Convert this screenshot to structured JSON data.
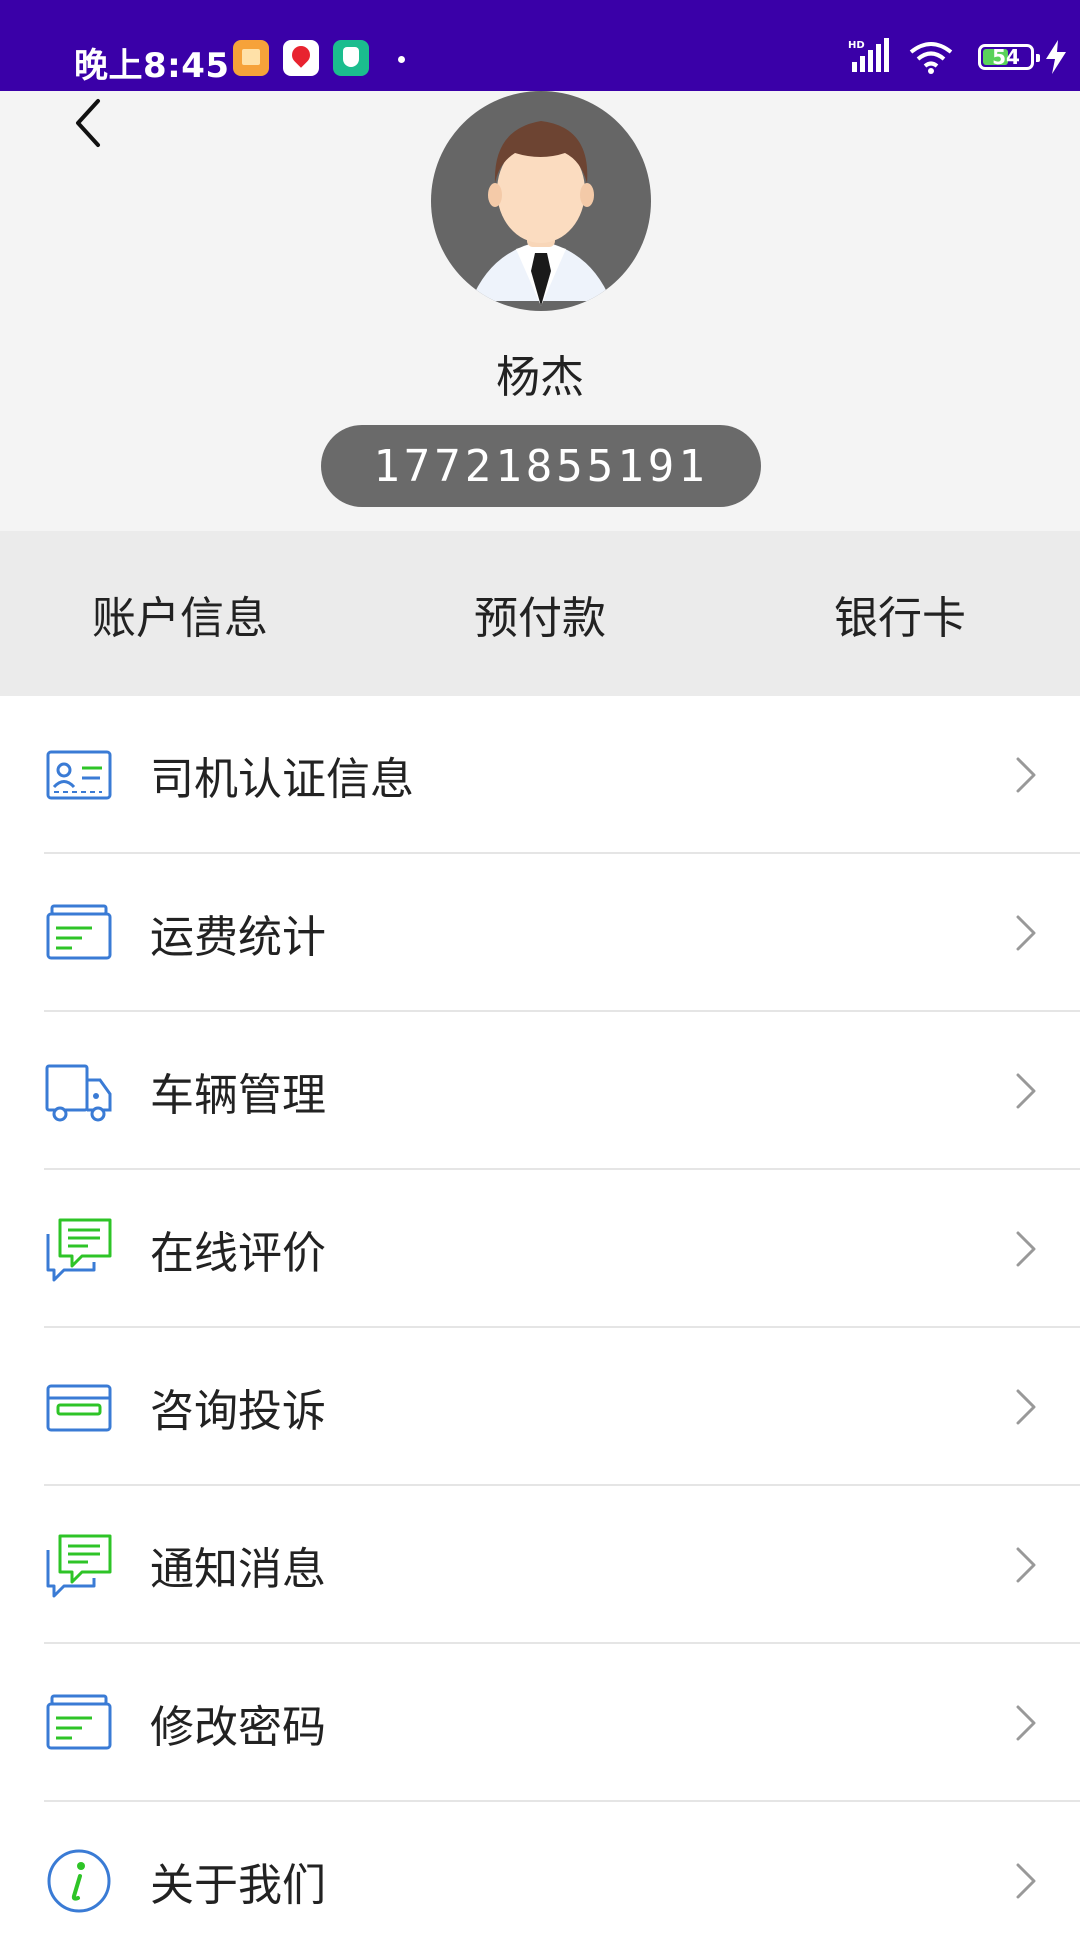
{
  "status_bar": {
    "time": "晚上8:45",
    "battery": "54",
    "battery_level": 0.54,
    "icons": [
      "app-notes-icon",
      "app-map-pin-icon",
      "app-shield-icon",
      "signal-hd-icon",
      "wifi-icon",
      "battery-icon",
      "charging-icon"
    ]
  },
  "header": {
    "name": "杨杰",
    "phone": "17721855191"
  },
  "tabs": [
    {
      "label": "账户信息"
    },
    {
      "label": "预付款"
    },
    {
      "label": "银行卡"
    }
  ],
  "menu": [
    {
      "label": "司机认证信息",
      "icon": "id-card-icon"
    },
    {
      "label": "运费统计",
      "icon": "statistics-card-icon"
    },
    {
      "label": "车辆管理",
      "icon": "truck-icon"
    },
    {
      "label": "在线评价",
      "icon": "chat-bubbles-icon"
    },
    {
      "label": "咨询投诉",
      "icon": "bank-card-icon"
    },
    {
      "label": "通知消息",
      "icon": "chat-bubbles-icon"
    },
    {
      "label": "修改密码",
      "icon": "statistics-card-icon"
    },
    {
      "label": "关于我们",
      "icon": "info-icon"
    }
  ],
  "colors": {
    "status_bar": "#3a00a8",
    "icon_blue": "#3a7bd5",
    "icon_green": "#2ec427",
    "header_bg": "#f4f4f4",
    "tab_bg": "#ebebeb",
    "pill": "#6a6a6a"
  }
}
